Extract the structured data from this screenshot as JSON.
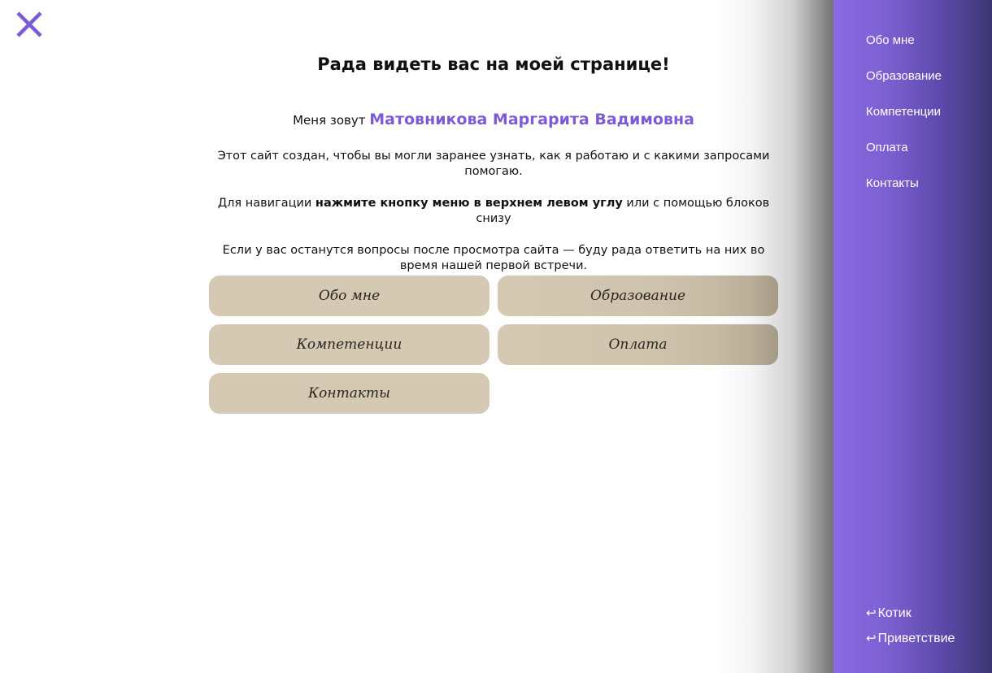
{
  "close_button": {
    "icon": "close-icon",
    "color": "#7d5bd6"
  },
  "main": {
    "title": "Рада видеть вас на моей странице!",
    "intro_prefix": "Меня зовут",
    "intro_name": "Матовникова Маргарита Вадимовна",
    "para1": "Этот сайт создан, чтобы вы могли заранее узнать, как я работаю и с какими запросами помогаю.",
    "para2_prefix": "Для навигации",
    "para2_bold": "нажмите кнопку меню в верхнем левом углу",
    "para2_suffix": "или с помощью блоков снизу",
    "para3": "Если у вас останутся вопросы после просмотра сайта — буду рада ответить на них во время нашей первой встречи."
  },
  "blocks": [
    {
      "label": "Обо мне"
    },
    {
      "label": "Образование"
    },
    {
      "label": "Компетенции"
    },
    {
      "label": "Оплата"
    },
    {
      "label": "Контакты"
    }
  ],
  "sidebar": {
    "items": [
      {
        "label": "Обо мне"
      },
      {
        "label": "Образование"
      },
      {
        "label": "Компетенции"
      },
      {
        "label": "Оплата"
      },
      {
        "label": "Контакты"
      }
    ],
    "bottom_links": [
      {
        "icon": "return-arrow-icon",
        "glyph": "↩",
        "label": "Котик"
      },
      {
        "icon": "return-arrow-icon",
        "glyph": "↩",
        "label": "Приветствие"
      }
    ]
  },
  "colors": {
    "accent": "#7d5bd6",
    "block_bg": "#d5c9b3",
    "sidebar_start": "#8b6be3",
    "sidebar_end": "#3c3672"
  }
}
